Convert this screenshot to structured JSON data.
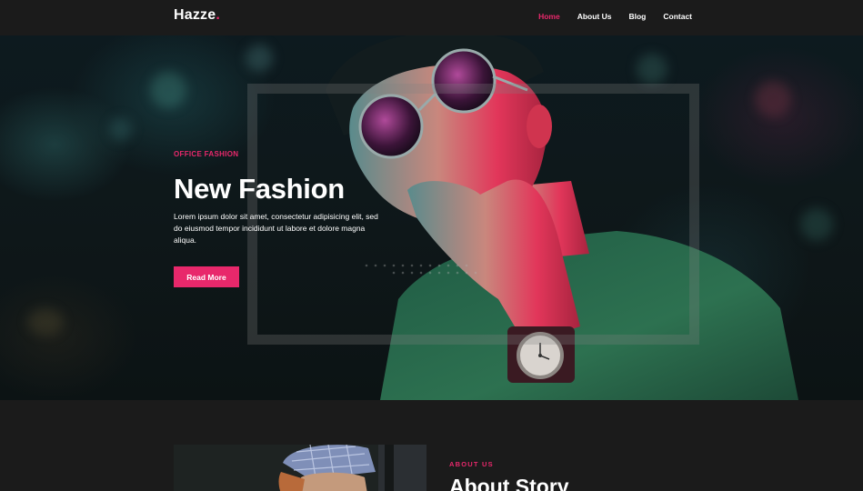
{
  "brand": {
    "name": "Hazze",
    "dot": "."
  },
  "nav": {
    "items": [
      {
        "label": "Home",
        "active": true
      },
      {
        "label": "About Us",
        "active": false
      },
      {
        "label": "Blog",
        "active": false
      },
      {
        "label": "Contact",
        "active": false
      }
    ]
  },
  "hero": {
    "eyebrow": "OFFICE FASHION",
    "title": "New Fashion",
    "text": "Lorem ipsum dolor sit amet, consectetur adipisicing elit, sed do eiusmod tempor incididunt ut labore et dolore magna aliqua.",
    "button_label": "Read More"
  },
  "about": {
    "eyebrow": "ABOUT US",
    "title": "About Story"
  },
  "colors": {
    "accent": "#e8286b",
    "background": "#1b1b1b",
    "hero_bg": "#0e1719"
  }
}
